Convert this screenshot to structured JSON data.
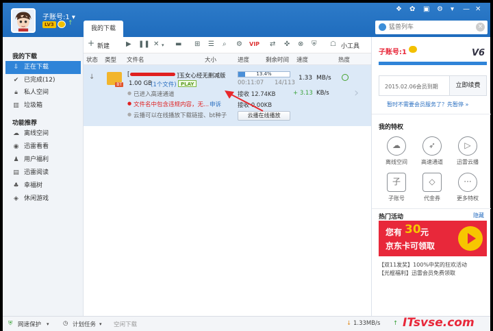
{
  "titlebar": {
    "username": "子账号:1 ▾",
    "level": "LV3",
    "tab_downloads": "我的下载",
    "search_placeholder": "猛兽列车"
  },
  "sidebar": {
    "section_downloads": "我的下载",
    "items_downloads": [
      {
        "icon": "download-icon",
        "label": "正在下载",
        "active": true
      },
      {
        "icon": "check-icon",
        "label": "已完成(12)"
      },
      {
        "icon": "lock-icon",
        "label": "私人空间"
      },
      {
        "icon": "trash-icon",
        "label": "垃圾箱"
      }
    ],
    "section_features": "功能推荐",
    "items_features": [
      {
        "icon": "cloud-icon",
        "label": "离线空间"
      },
      {
        "icon": "eye-icon",
        "label": "迅雷看看"
      },
      {
        "icon": "user-icon",
        "label": "用户福利"
      },
      {
        "icon": "book-icon",
        "label": "迅雷阅读"
      },
      {
        "icon": "tree-icon",
        "label": "幸福树"
      },
      {
        "icon": "game-icon",
        "label": "休闲游戏"
      }
    ]
  },
  "toolbar": {
    "new_label": "新建",
    "tools_label": "小工具"
  },
  "columns": [
    "状态",
    "类型",
    "文件名",
    "大小",
    "进度",
    "剩余时间",
    "速度",
    "热度"
  ],
  "task": {
    "name_suffix": "]玉女心经无删减版",
    "size": "1.00 GB",
    "file_count": "(1个文件)",
    "play_badge": "PLAY",
    "file_badge": "BT",
    "line_high_speed": "已进入高速通道",
    "line_warning": "文件名中包含违规内容，无...",
    "appeal_link": "申诉",
    "line_cloud": "云播可以在线播放下载链接、bt种子",
    "progress_percent": "13.4%",
    "progress_value": 0.134,
    "elapsed": "00:11:07",
    "pieces": "14/113",
    "received_1": "接收 12.74KB",
    "received_2": "接收 0.00KB",
    "speed_main": "1.33",
    "speed_main_unit": "MB/s",
    "speed_extra": "+ 3.13",
    "speed_extra_unit": "KB/s",
    "cloud_play_button": "云播在线播放"
  },
  "right_panel": {
    "account": "子账号:1",
    "vip_logo": "V6",
    "expire_text": "2015.02.06会员到期",
    "renew_button": "立即续费",
    "hint_text": "暂时不需要会员服务了？先暂停 »",
    "privileges_title": "我的特权",
    "features": [
      {
        "icon": "cloud-download-icon",
        "label": "离线空间"
      },
      {
        "icon": "rocket-icon",
        "label": "高速通道"
      },
      {
        "icon": "cloud-play-icon",
        "label": "迅雷云播"
      },
      {
        "icon": "sub-account-icon",
        "label": "子账号"
      },
      {
        "icon": "voucher-icon",
        "label": "代金券"
      },
      {
        "icon": "more-icon",
        "label": "更多特权"
      }
    ],
    "activity_title": "热门活动",
    "hide_link": "隐藏",
    "banner_line1_a": "您有",
    "banner_amount": "30",
    "banner_line1_b": "元",
    "banner_line2": "京东卡可领取",
    "news": [
      "【双11发奖】100%中奖的狂欢活动",
      "【光棍福利】迅雷会员免费领取"
    ]
  },
  "statusbar": {
    "protect": "网速保护",
    "schedule": "计划任务",
    "idle": "空闲下载",
    "down_speed": "1.33MB/s",
    "watermark": "ITsvse.com"
  },
  "colors": {
    "title_blue": "#2d7bc9",
    "selected_row": "#dce9f7",
    "accent_red": "#e8283a",
    "banner_yellow": "#f7c600"
  }
}
